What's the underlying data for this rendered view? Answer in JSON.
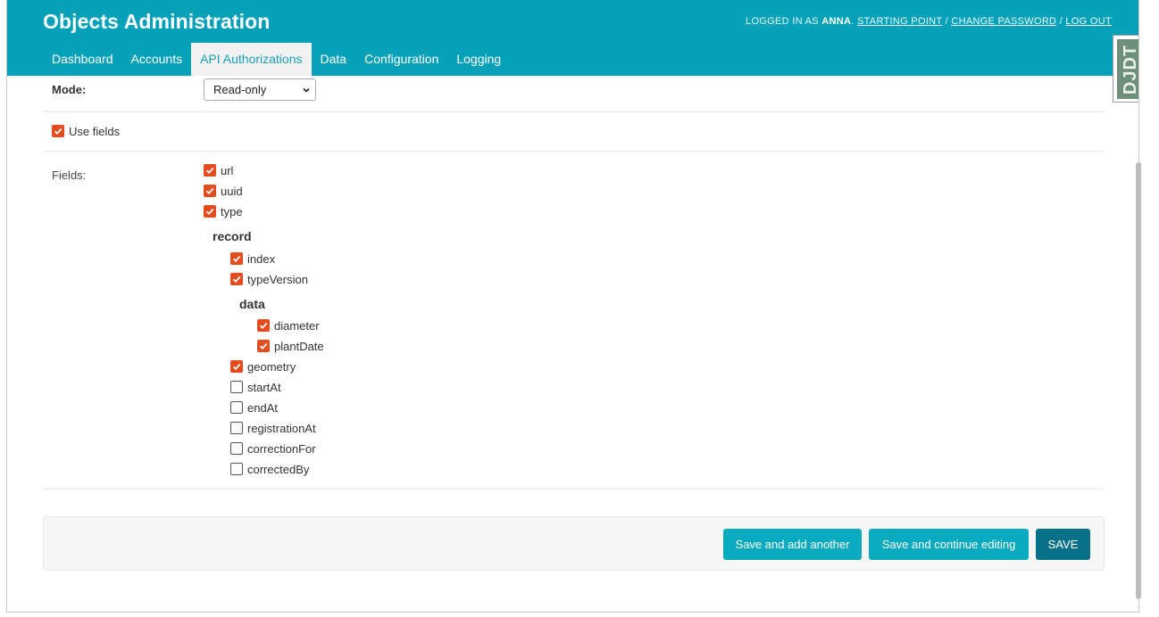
{
  "header": {
    "site_name": "Objects Administration",
    "user_tools": {
      "logged_in_prefix": "LOGGED IN AS",
      "username": "ANNA",
      "starting_point": "STARTING POINT",
      "change_password": "CHANGE PASSWORD",
      "log_out": "LOG OUT",
      "separator": "/"
    }
  },
  "nav": {
    "tabs": [
      {
        "label": "Dashboard",
        "active": false
      },
      {
        "label": "Accounts",
        "active": false
      },
      {
        "label": "API Authorizations",
        "active": true
      },
      {
        "label": "Data",
        "active": false
      },
      {
        "label": "Configuration",
        "active": false
      },
      {
        "label": "Logging",
        "active": false
      }
    ]
  },
  "djdt": {
    "label": "DJDT"
  },
  "form": {
    "mode_label": "Mode:",
    "mode_value": "Read-only",
    "use_fields": {
      "label": "Use fields",
      "checked": true
    },
    "fields_label": "Fields:",
    "fields": {
      "url": {
        "label": "url",
        "checked": true
      },
      "uuid": {
        "label": "uuid",
        "checked": true
      },
      "type": {
        "label": "type",
        "checked": true
      },
      "record_title": "record",
      "index": {
        "label": "index",
        "checked": true
      },
      "typeVersion": {
        "label": "typeVersion",
        "checked": true
      },
      "data_title": "data",
      "diameter": {
        "label": "diameter",
        "checked": true
      },
      "plantDate": {
        "label": "plantDate",
        "checked": true
      },
      "geometry": {
        "label": "geometry",
        "checked": true
      },
      "startAt": {
        "label": "startAt",
        "checked": false
      },
      "endAt": {
        "label": "endAt",
        "checked": false
      },
      "registrationAt": {
        "label": "registrationAt",
        "checked": false
      },
      "correctionFor": {
        "label": "correctionFor",
        "checked": false
      },
      "correctedBy": {
        "label": "correctedBy",
        "checked": false
      }
    }
  },
  "submit": {
    "save_add_another": "Save and add another",
    "save_continue": "Save and continue editing",
    "save": "SAVE"
  },
  "colors": {
    "header_bg": "#05a1b8",
    "checkbox_checked": "#e24c1f",
    "primary_button": "#08718a",
    "secondary_button": "#0aaabf"
  }
}
